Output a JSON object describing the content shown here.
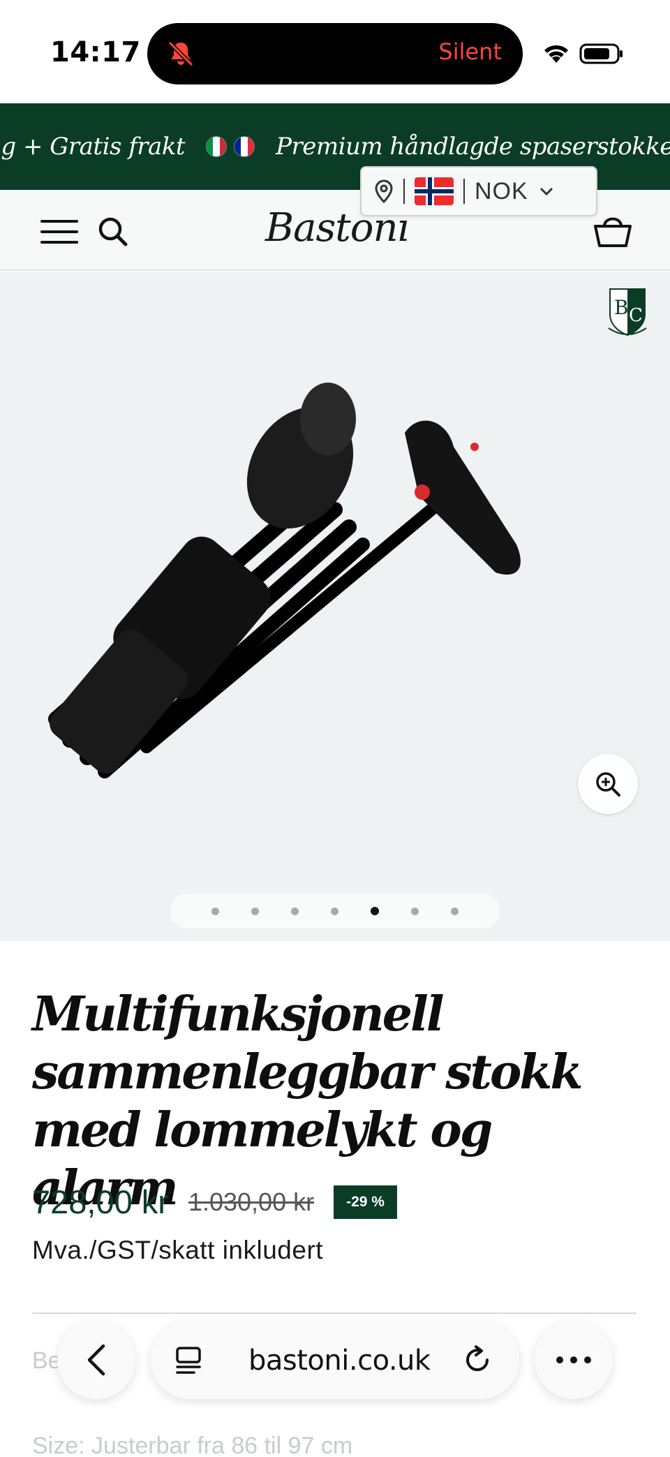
{
  "status_bar": {
    "time": "14:17",
    "mode_label": "Silent"
  },
  "banner": {
    "segments": [
      "ong + Gratis frakt",
      "Premium håndlagde spaserstokker"
    ],
    "colors": {
      "background": "#0b3d26"
    }
  },
  "header": {
    "logo_text": "Bastoni",
    "icons": [
      "menu-icon",
      "search-icon",
      "cart-icon"
    ]
  },
  "currency_selector": {
    "currency": "NOK",
    "country_flag": "norway"
  },
  "gallery": {
    "image_count": 7,
    "active_index": 4,
    "badge": "BC"
  },
  "product": {
    "title": "Multifunksjonell sammenleggbar stokk med lommelykt og alarm",
    "price_current": "728,00 kr",
    "price_old": "1.030,00 kr",
    "discount": "-29 %",
    "tax_note": "Mva./GST/skatt inkludert",
    "partial_line": "Be                    a",
    "size_line": "Size:  Justerbar fra 86 til 97 cm"
  },
  "browser": {
    "url": "bastoni.co.uk"
  },
  "colors": {
    "brand_green": "#0b3d26",
    "silent_red": "#ff453a"
  }
}
